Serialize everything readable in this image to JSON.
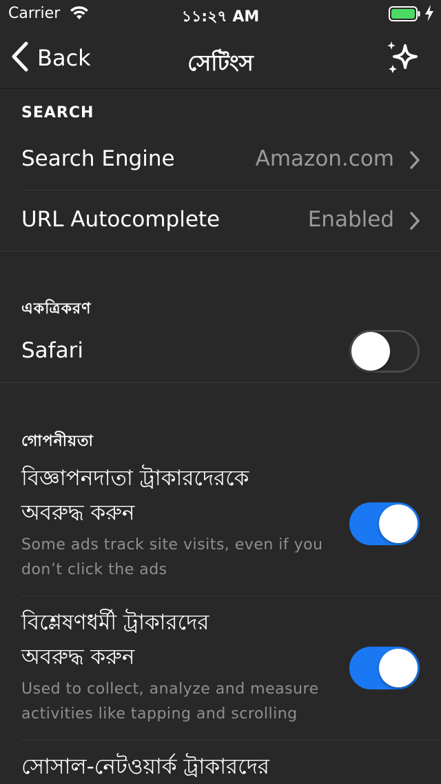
{
  "status_bar": {
    "carrier": "Carrier",
    "time": "১১:২৭ AM"
  },
  "nav": {
    "back_label": "Back",
    "title": "সেটিংস",
    "action_icon": "sparkle-icon"
  },
  "sections": {
    "search": {
      "header": "SEARCH",
      "search_engine": {
        "label": "Search Engine",
        "value": "Amazon.com"
      },
      "url_autocomplete": {
        "label": "URL Autocomplete",
        "value": "Enabled"
      }
    },
    "integration": {
      "header": "একত্রিকরণ",
      "safari": {
        "label": "Safari",
        "enabled": false
      }
    },
    "privacy": {
      "header": "গোপনীয়তা",
      "ad_trackers": {
        "title_line1": "বিজ্ঞাপনদাতা ট্রাকারদেরকে",
        "title_line2": "অবরুদ্ধ করুন",
        "subtitle_line1": "Some ads track site visits, even if you",
        "subtitle_line2": "don’t click the ads",
        "enabled": true
      },
      "analytics_trackers": {
        "title_line1": "বিশ্লেষণধর্মী ট্রাকারদের",
        "title_line2": "অবরুদ্ধ করুন",
        "subtitle_line1": "Used to collect, analyze and measure",
        "subtitle_line2": "activities like tapping and scrolling",
        "enabled": true
      },
      "social_trackers": {
        "title_line1": "সোসাল-নেটওয়ার্ক ট্রাকারদের"
      }
    }
  },
  "colors": {
    "background": "#282828",
    "accent": "#1a78f2",
    "battery": "#4cd964"
  }
}
